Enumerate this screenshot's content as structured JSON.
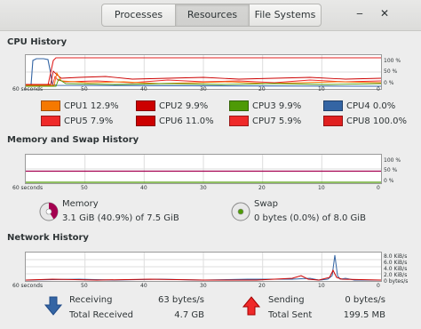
{
  "tabs": [
    {
      "label": "Processes"
    },
    {
      "label": "Resources"
    },
    {
      "label": "File Systems"
    }
  ],
  "window_controls": {
    "minimize": "‒",
    "close": "✕"
  },
  "cpu": {
    "title": "CPU History",
    "pct_ticks": [
      "100 %",
      "50 %",
      "0 %"
    ],
    "time_ticks": [
      "60 seconds",
      "50",
      "40",
      "30",
      "20",
      "10",
      "0"
    ],
    "cores": [
      {
        "label": "CPU1",
        "value": "12.9%",
        "color": "#f57900"
      },
      {
        "label": "CPU2",
        "value": "9.9%",
        "color": "#cc0000"
      },
      {
        "label": "CPU3",
        "value": "9.9%",
        "color": "#4e9a06"
      },
      {
        "label": "CPU4",
        "value": "0.0%",
        "color": "#3465a4"
      },
      {
        "label": "CPU5",
        "value": "7.9%",
        "color": "#ef2929"
      },
      {
        "label": "CPU6",
        "value": "11.0%",
        "color": "#cc0000"
      },
      {
        "label": "CPU7",
        "value": "5.9%",
        "color": "#ef2929"
      },
      {
        "label": "CPU8",
        "value": "100.0%",
        "color": "#e02020"
      }
    ]
  },
  "memory": {
    "title": "Memory and Swap History",
    "pct_ticks": [
      "100 %",
      "50 %",
      "0 %"
    ],
    "time_ticks": [
      "60 seconds",
      "50",
      "40",
      "30",
      "20",
      "10",
      "0"
    ],
    "mem_label": "Memory",
    "mem_value": "3.1 GiB (40.9%) of 7.5 GiB",
    "mem_fraction": 0.409,
    "mem_color": "#a40050",
    "swap_label": "Swap",
    "swap_value": "0 bytes (0.0%) of 8.0 GiB",
    "swap_fraction": 0.0,
    "swap_color": "#4e9a06"
  },
  "network": {
    "title": "Network History",
    "rate_ticks": [
      "8.0 KiB/s",
      "6.0 KiB/s",
      "4.0 KiB/s",
      "2.0 KiB/s",
      "0 bytes/s"
    ],
    "time_ticks": [
      "60 seconds",
      "50",
      "40",
      "30",
      "20",
      "10",
      "0"
    ],
    "receiving_label": "Receiving",
    "receiving_value": "63 bytes/s",
    "total_received_label": "Total Received",
    "total_received_value": "4.7 GB",
    "sending_label": "Sending",
    "sending_value": "0 bytes/s",
    "total_sent_label": "Total Sent",
    "total_sent_value": "199.5 MB",
    "receive_color": "#3465a4",
    "send_color": "#cc0000"
  }
}
